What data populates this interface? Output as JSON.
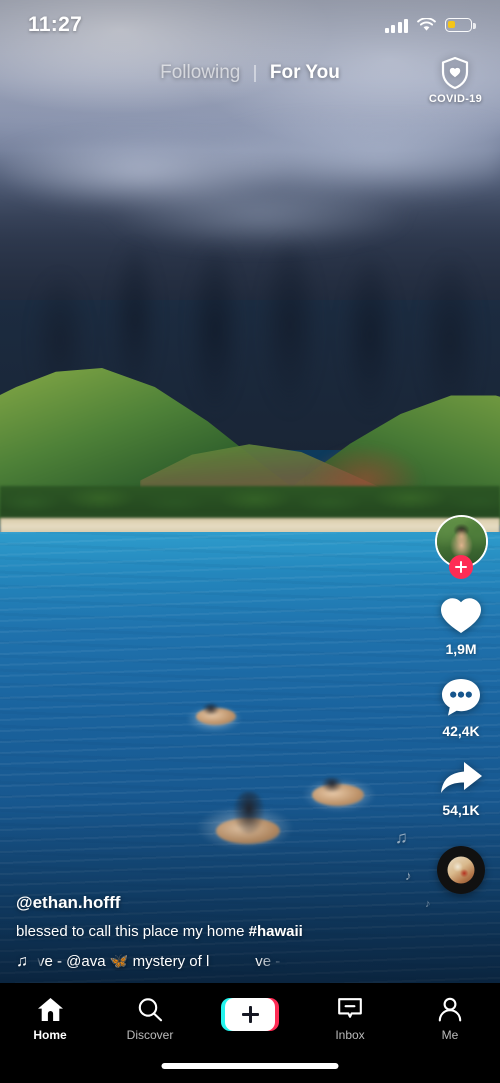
{
  "status_bar": {
    "time": "11:27",
    "signal_icon": "cellular-signal-icon",
    "wifi_icon": "wifi-icon",
    "battery_icon": "battery-low-icon"
  },
  "top_nav": {
    "following_label": "Following",
    "for_you_label": "For You",
    "active_tab": "For You"
  },
  "covid_badge": {
    "label": "COVID-19",
    "icon": "shield-heart-icon"
  },
  "video": {
    "author_handle": "@ethan.hofff",
    "description_text": "blessed to call this place my home ",
    "hashtag": "#hawaii",
    "music_note_icon": "music-note-icon",
    "music_ticker": "ve - @ava 🦋    mystery of l",
    "disc_icon": "vinyl-record-icon"
  },
  "actions": {
    "avatar_name": "creator-avatar",
    "follow_icon": "plus-icon",
    "like": {
      "icon": "heart-icon",
      "count": "1,9M"
    },
    "comment": {
      "icon": "comment-bubble-icon",
      "count": "42,4K"
    },
    "share": {
      "icon": "share-arrow-icon",
      "count": "54,1K"
    }
  },
  "bottom_nav": {
    "items": [
      {
        "label": "Home",
        "icon": "home-icon",
        "active": true
      },
      {
        "label": "Discover",
        "icon": "search-icon",
        "active": false
      },
      {
        "label": "",
        "icon": "create-plus-icon",
        "active": false
      },
      {
        "label": "Inbox",
        "icon": "inbox-icon",
        "active": false
      },
      {
        "label": "Me",
        "icon": "person-icon",
        "active": false
      }
    ]
  },
  "colors": {
    "brand_pink": "#fe2c55",
    "brand_cyan": "#25f4ee",
    "nav_background": "#000000",
    "battery_low": "#f5c518"
  }
}
